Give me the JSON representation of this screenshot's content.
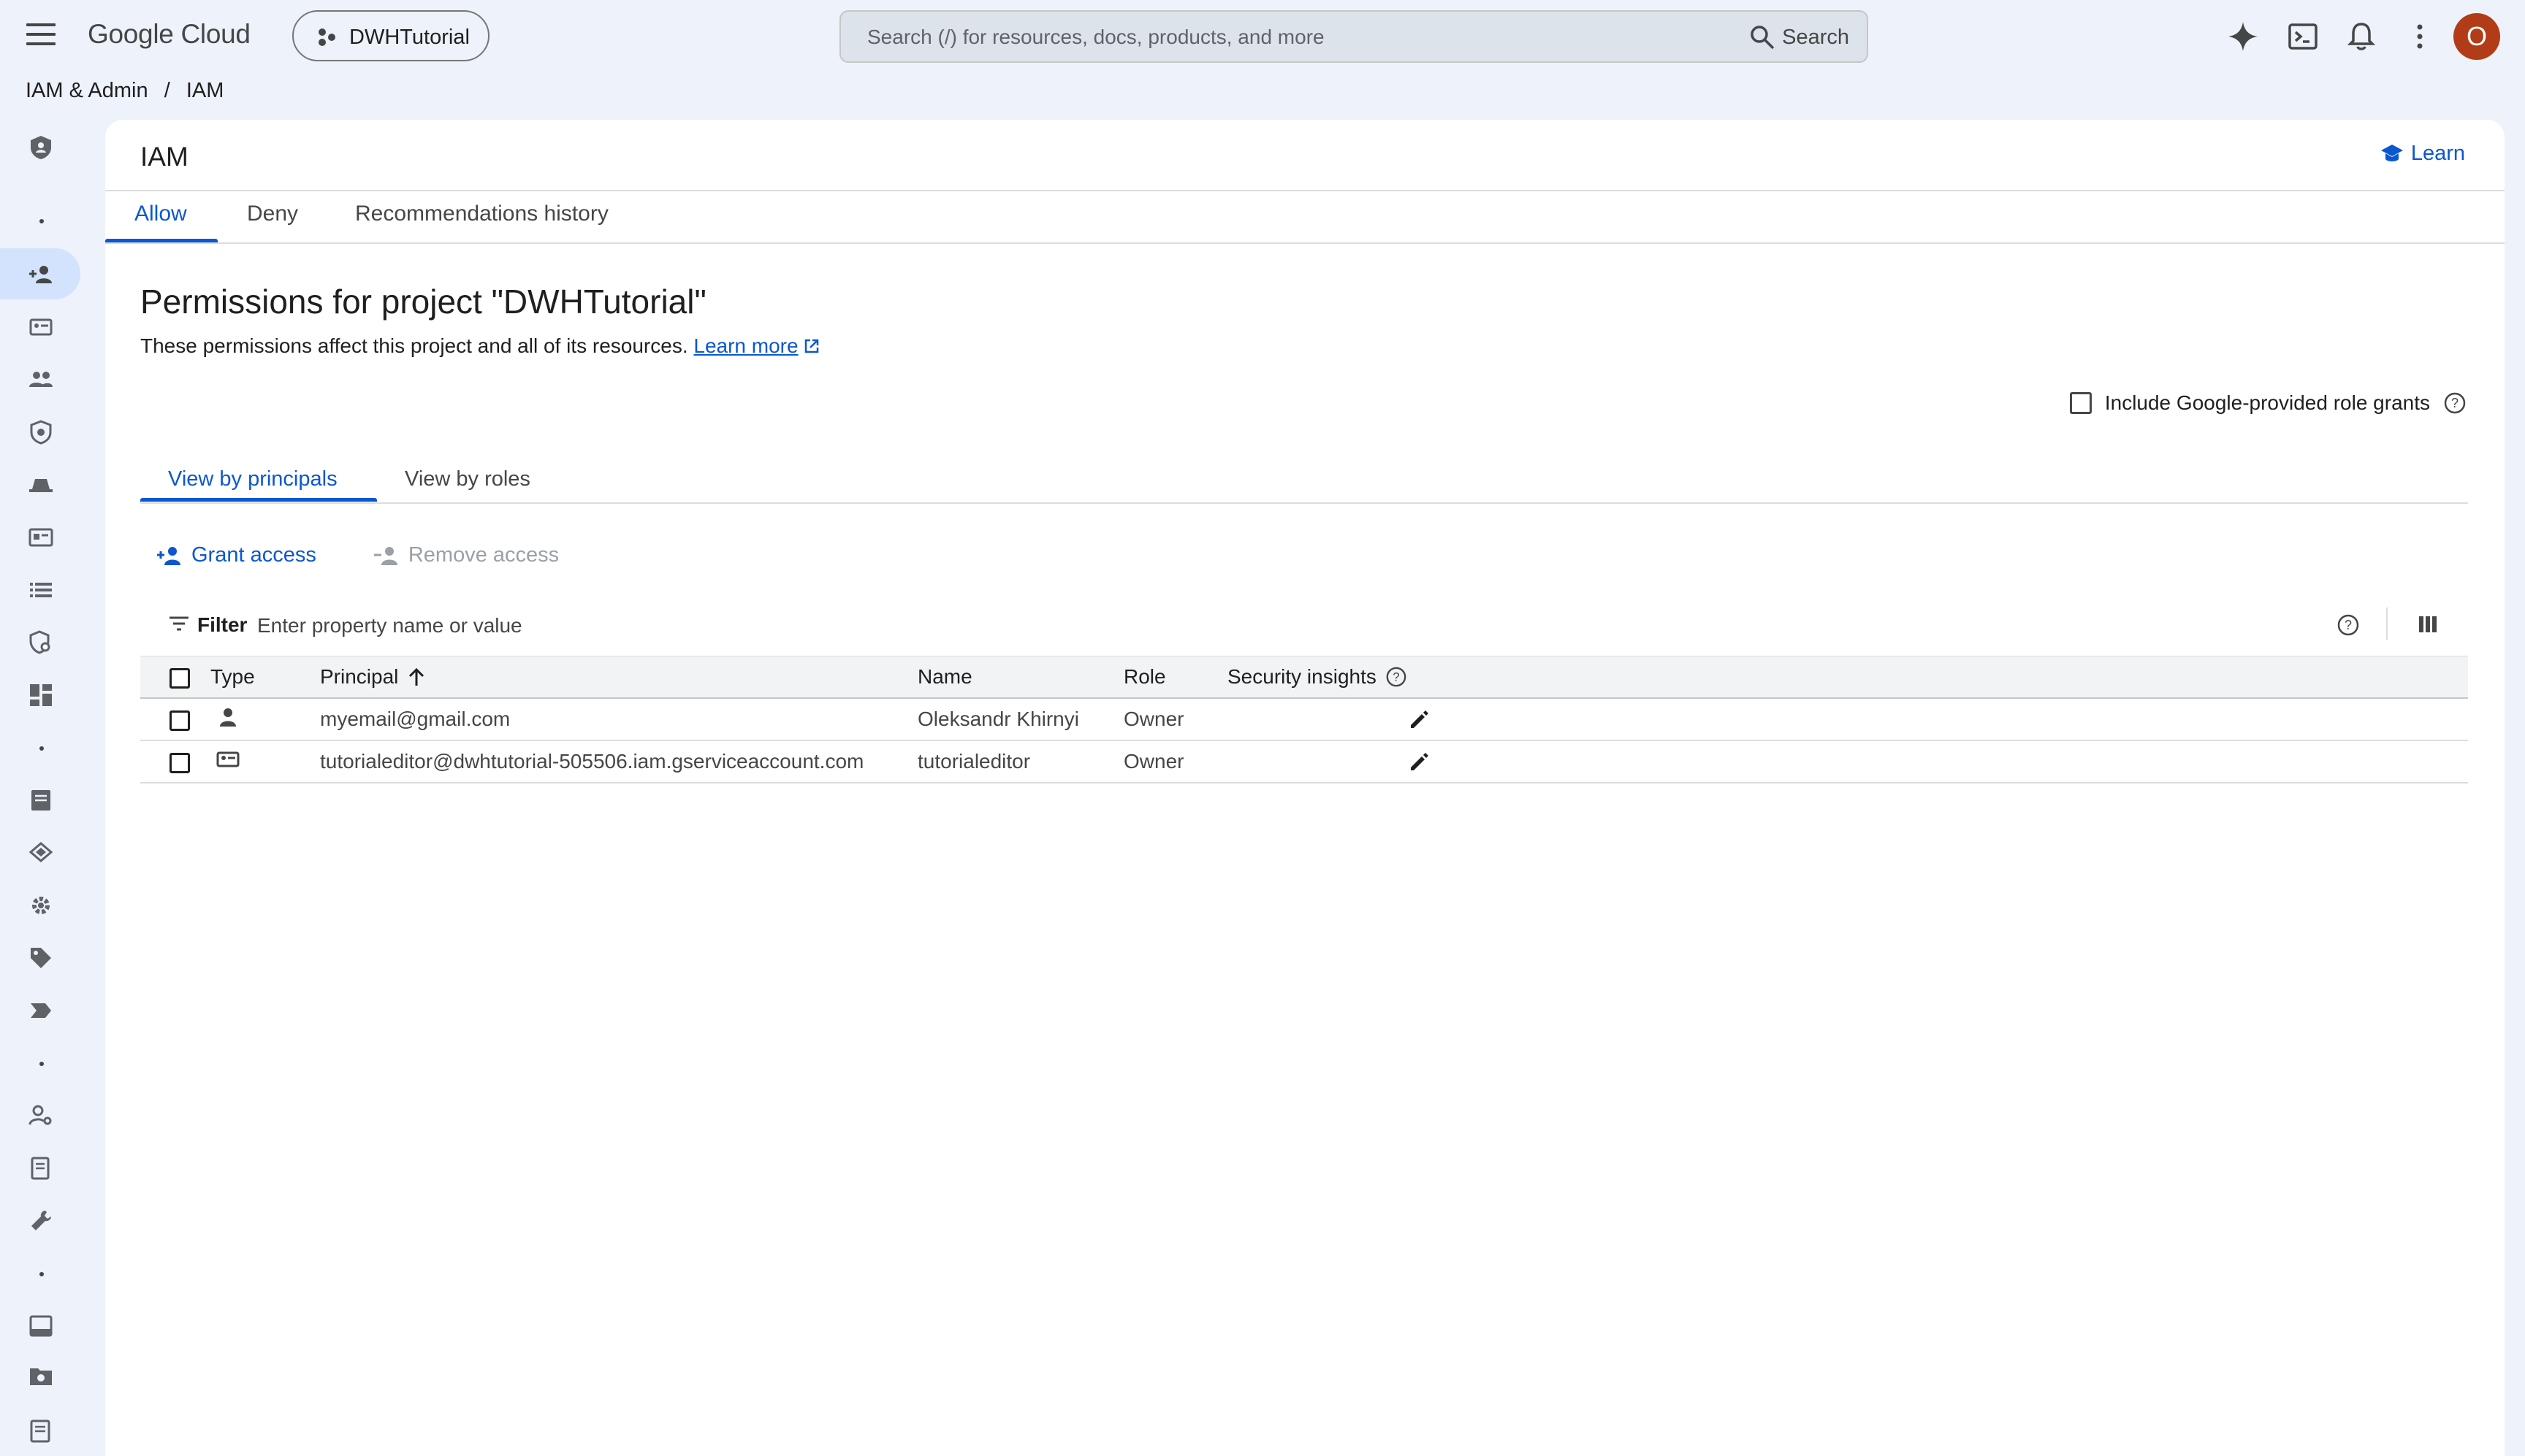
{
  "topbar": {
    "brand": "Google Cloud",
    "project": "DWHTutorial",
    "search_placeholder": "Search (/) for resources, docs, products, and more",
    "search_button": "Search",
    "avatar_initial": "O"
  },
  "breadcrumb": [
    "IAM & Admin",
    "/",
    "IAM"
  ],
  "page": {
    "title": "IAM",
    "learn_label": "Learn",
    "tabs": [
      "Allow",
      "Deny",
      "Recommendations history"
    ],
    "heading": "Permissions for project \"DWHTutorial\"",
    "description": "These permissions affect this project and all of its resources.",
    "learn_more": "Learn more",
    "include_google_grants": "Include Google-provided role grants",
    "view_tabs": [
      "View by principals",
      "View by roles"
    ],
    "grant_access": "Grant access",
    "remove_access": "Remove access",
    "filter_label": "Filter",
    "filter_placeholder": "Enter property name or value"
  },
  "table": {
    "headers": {
      "type": "Type",
      "principal": "Principal",
      "name": "Name",
      "role": "Role",
      "security_insights": "Security insights"
    },
    "rows": [
      {
        "principal": "myemail@gmail.com",
        "name": "Oleksandr Khirnyi",
        "role": "Owner",
        "type_icon": "person-icon"
      },
      {
        "principal": "tutorialeditor@dwhtutorial-505506.iam.gserviceaccount.com",
        "name": "tutorialeditor",
        "role": "Owner",
        "type_icon": "service-account-icon"
      }
    ]
  },
  "colors": {
    "accent": "#0b57d0",
    "avatar": "#b23c17",
    "background": "#eef2fa"
  }
}
